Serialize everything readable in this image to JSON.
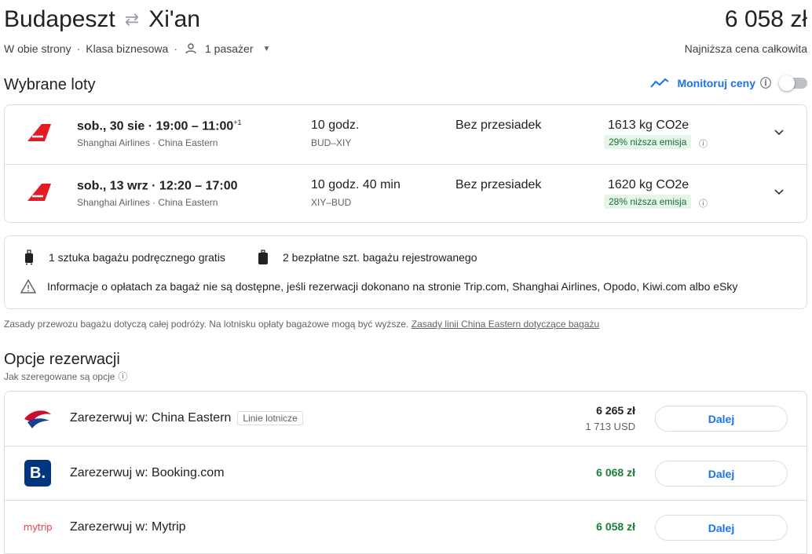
{
  "header": {
    "origin": "Budapeszt",
    "destination": "Xi'an",
    "swap_icon": "swap-arrows-icon",
    "total_price": "6 058 zł",
    "total_caption": "Najniższa cena całkowita",
    "trip_type": "W obie strony",
    "cabin": "Klasa biznesowa",
    "passengers": "1 pasażer"
  },
  "selected": {
    "title": "Wybrane loty",
    "monitor_label": "Monitoruj ceny",
    "flights": [
      {
        "time": "sob., 30 sie  ·  19:00 – 11:00",
        "day_offset": "+1",
        "airlines": "Shanghai Airlines · China Eastern",
        "duration": "10 godz.",
        "route": "BUD–XIY",
        "stops": "Bez przesiadek",
        "co2": "1613 kg CO2e",
        "emission": "29% niższa emisja"
      },
      {
        "time": "sob., 13 wrz  ·  12:20 – 17:00",
        "day_offset": "",
        "airlines": "Shanghai Airlines · China Eastern",
        "duration": "10 godz. 40 min",
        "route": "XIY–BUD",
        "stops": "Bez przesiadek",
        "co2": "1620 kg CO2e",
        "emission": "28% niższa emisja"
      }
    ]
  },
  "baggage": {
    "carry_on": "1 sztuka bagażu podręcznego gratis",
    "checked": "2 bezpłatne szt. bagażu rejestrowanego",
    "warning": "Informacje o opłatach za bagaż nie są dostępne, jeśli rezerwacji dokonano na stronie Trip.com, Shanghai Airlines, Opodo, Kiwi.com albo eSky",
    "note": "Zasady przewozu bagażu dotyczą całej podróży. Na lotnisku opłaty bagażowe mogą być wyższe.",
    "link": "Zasady linii China Eastern dotyczące bagażu"
  },
  "booking": {
    "title": "Opcje rezerwacji",
    "ranked": "Jak szeregowane są opcje",
    "options": [
      {
        "label": "Zarezerwuj w: China Eastern",
        "tag": "Linie lotnicze",
        "price": "6 265 zł",
        "sub": "1 713 USD",
        "button": "Dalej",
        "logo": "china-eastern-logo"
      },
      {
        "label": "Zarezerwuj w: Booking.com",
        "tag": "",
        "price": "6 068 zł",
        "sub": "",
        "button": "Dalej",
        "logo": "booking-logo",
        "logo_text": "B."
      },
      {
        "label": "Zarezerwuj w: Mytrip",
        "tag": "",
        "price": "6 058 zł",
        "sub": "",
        "button": "Dalej",
        "logo": "mytrip-logo",
        "logo_text": "mytrip"
      }
    ]
  },
  "colors": {
    "accent": "#1a73e8",
    "green": "#188038",
    "airline_red": "#e31b23",
    "booking_blue": "#003580"
  }
}
